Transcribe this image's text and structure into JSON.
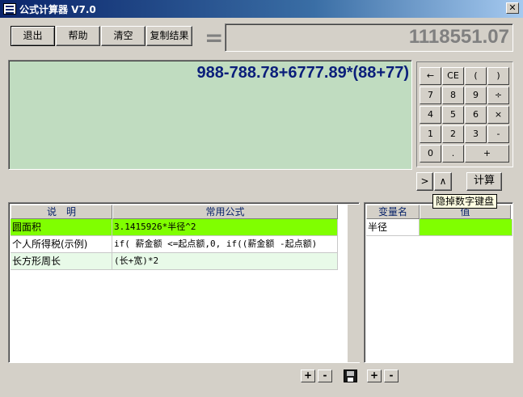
{
  "window": {
    "title": "公式计算器 V7.0",
    "close": "✕"
  },
  "toolbar": {
    "exit": "退出",
    "help": "帮助",
    "clear": "清空",
    "copy": "复制结果"
  },
  "equals": "=",
  "result": "1118551.07",
  "expression": "988-788.78+6777.89*(88+77)",
  "keypad": {
    "rows": [
      [
        "←",
        "CE",
        "(",
        ")"
      ],
      [
        "7",
        "8",
        "9",
        "÷"
      ],
      [
        "4",
        "5",
        "6",
        "×"
      ],
      [
        "1",
        "2",
        "3",
        "-"
      ],
      [
        "0",
        ".",
        "+"
      ]
    ]
  },
  "controls": {
    "next": ">",
    "caret": "∧",
    "calc": "计算"
  },
  "tooltip": "隐掉数字键盘",
  "formulas": {
    "headers": [
      "说　明",
      "常用公式"
    ],
    "rows": [
      {
        "desc": "圆面积",
        "formula": "3.1415926*半径^2"
      },
      {
        "desc": "个人所得税(示例)",
        "formula": "if( 薪金额 <=起点额,0, if((薪金额 -起点额)"
      },
      {
        "desc": "长方形周长",
        "formula": "(长+宽)*2"
      }
    ]
  },
  "variables": {
    "headers": [
      "变量名",
      "值"
    ],
    "rows": [
      {
        "name": "半径",
        "value": ""
      }
    ]
  },
  "bottom": {
    "plus": "+",
    "minus": "-"
  }
}
